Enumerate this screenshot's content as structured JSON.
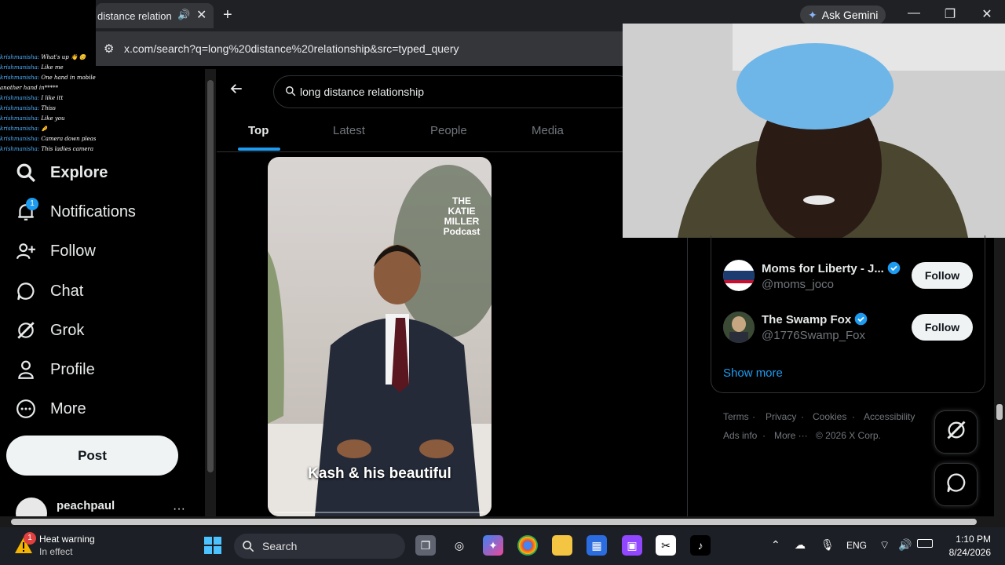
{
  "browser": {
    "tab_title": "distance relationshi",
    "url": "x.com/search?q=long%20distance%20relationship&src=typed_query",
    "ask_gemini": "Ask Gemini"
  },
  "chat_overlay": [
    {
      "user": "krishmanisha:",
      "text": "What's up 👋 😊"
    },
    {
      "user": "krishmanisha:",
      "text": "Like me"
    },
    {
      "user": "krishmanisha:",
      "text": "One hand in mobile"
    },
    {
      "user": "",
      "text": "another hand in*****"
    },
    {
      "user": "krishmanisha:",
      "text": "I like itt"
    },
    {
      "user": "krishmanisha:",
      "text": "Thiss"
    },
    {
      "user": "krishmanisha:",
      "text": "Like you"
    },
    {
      "user": "krishmanisha:",
      "text": "🤌"
    },
    {
      "user": "krishmanisha:",
      "text": "Camera down please"
    },
    {
      "user": "krishmanisha:",
      "text": "This ladies camera"
    }
  ],
  "sidebar": {
    "items": [
      {
        "label": "Explore",
        "icon": "search-icon"
      },
      {
        "label": "Notifications",
        "icon": "bell-icon",
        "badge": "1"
      },
      {
        "label": "Follow",
        "icon": "add-person-icon"
      },
      {
        "label": "Chat",
        "icon": "chat-bubble-icon"
      },
      {
        "label": "Grok",
        "icon": "grok-icon"
      },
      {
        "label": "Profile",
        "icon": "person-icon"
      },
      {
        "label": "More",
        "icon": "more-circle-icon"
      }
    ],
    "post_label": "Post",
    "username": "peachpaul",
    "more_dots": "···"
  },
  "search": {
    "query": "long distance relationship",
    "tabs": [
      "Top",
      "Latest",
      "People",
      "Media"
    ],
    "active_tab": "Top"
  },
  "video": {
    "logo": "THE KATIE MILLER Podcast",
    "caption": "Kash & his beautiful"
  },
  "who_to_follow": {
    "accounts": [
      {
        "name": "Moms for Liberty - J...",
        "handle": "@moms_joco",
        "verified": true,
        "button": "Follow"
      },
      {
        "name": "The Swamp Fox",
        "handle": "@1776Swamp_Fox",
        "verified": true,
        "button": "Follow"
      }
    ],
    "show_more": "Show more"
  },
  "footer": {
    "links": [
      "Terms",
      "Privacy",
      "Cookies",
      "Accessibility",
      "Ads info",
      "More ···",
      "© 2026 X Corp."
    ]
  },
  "taskbar": {
    "weather_title": "Heat warning",
    "weather_sub": "In effect",
    "weather_badge": "1",
    "search_label": "Search",
    "language": "ENG",
    "time": "1:10 PM",
    "date": "8/24/2026"
  },
  "colors": {
    "accent": "#1d9bf0",
    "background": "#000000",
    "text": "#e7e9ea",
    "muted": "#71767b"
  }
}
